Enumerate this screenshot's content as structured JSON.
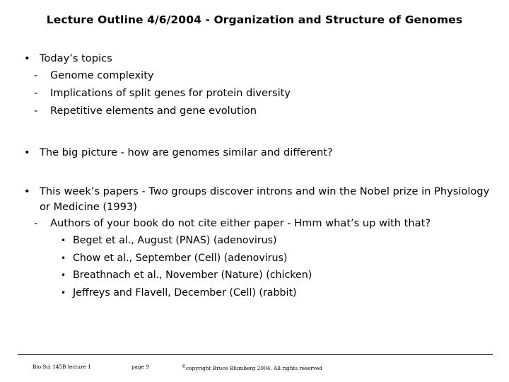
{
  "slide": {
    "title": "Lecture Outline 4/6/2004 - Organization and Structure of Genomes",
    "background_color": "#ffffff",
    "text_color": "#000000",
    "bullet_glyphs": {
      "level1": "•",
      "level2": "-",
      "level3": "•"
    },
    "outline": {
      "item1": {
        "text": "Today’s topics",
        "sub": [
          "Genome complexity",
          "Implications of split genes for protein diversity",
          "Repetitive elements and gene evolution"
        ]
      },
      "item2": {
        "text": "The big picture - how are genomes similar and different?"
      },
      "item3": {
        "text": "This week’s papers - Two groups discover introns and win the Nobel prize in Physiology or Medicine (1993)",
        "sub": "Authors of your book do not cite either paper - Hmm what’s up with that?",
        "papers": [
          "Beget et al., August (PNAS) (adenovirus)",
          "Chow et al., September (Cell) (adenovirus)",
          "Breathnach et al., November (Nature) (chicken)",
          "Jeffreys and Flavell, December (Cell) (rabbit)"
        ]
      }
    },
    "footer": {
      "course": "Bio Sci 145B lecture 1",
      "page": "page 9",
      "copyright_mark": "©",
      "copyright": "copyright Bruce Blumberg 2004. All rights reserved"
    }
  }
}
